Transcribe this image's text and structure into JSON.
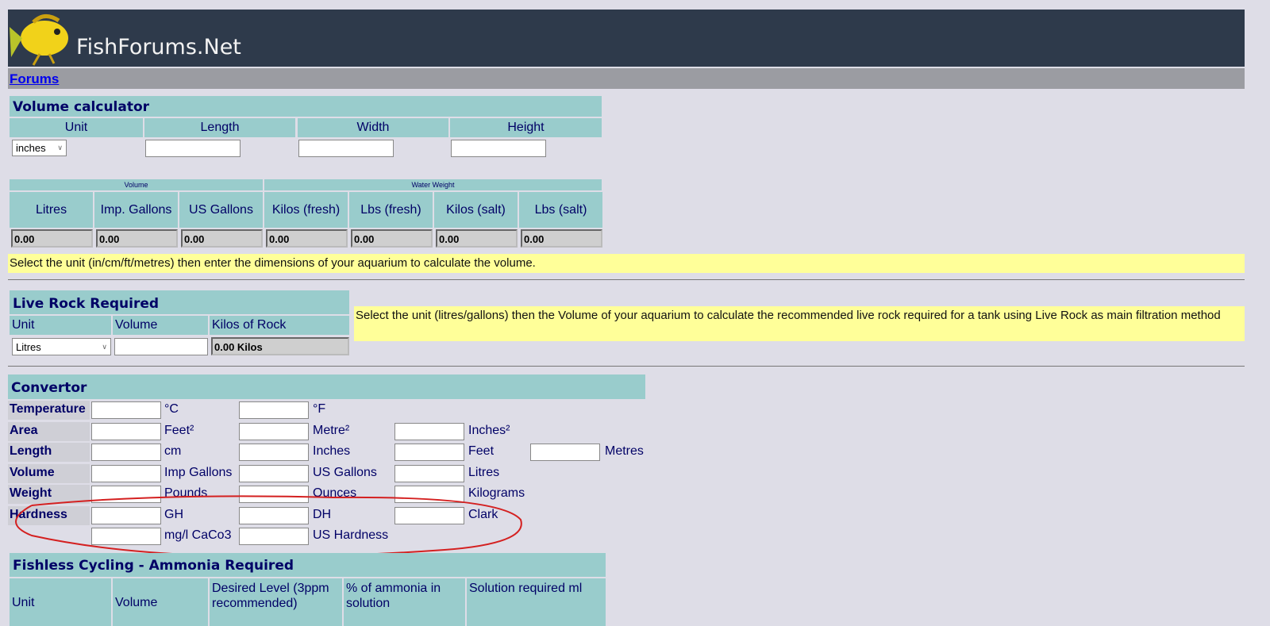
{
  "header": {
    "site_name": "FishForums.Net"
  },
  "nav": {
    "forums_link": "Forums"
  },
  "volume_calculator": {
    "title": "Volume calculator",
    "columns": [
      "Unit",
      "Length",
      "Width",
      "Height"
    ],
    "unit_selected": "inches",
    "group_headers": [
      "Volume",
      "Water Weight"
    ],
    "result_headers": [
      "Litres",
      "Imp. Gallons",
      "US Gallons",
      "Kilos (fresh)",
      "Lbs (fresh)",
      "Kilos (salt)",
      "Lbs (salt)"
    ],
    "result_values": [
      "0.00",
      "0.00",
      "0.00",
      "0.00",
      "0.00",
      "0.00",
      "0.00"
    ],
    "note": "Select the unit (in/cm/ft/metres) then enter the dimensions of your aquarium to calculate the volume."
  },
  "live_rock": {
    "title": "Live Rock Required",
    "columns": [
      "Unit",
      "Volume",
      "Kilos of Rock"
    ],
    "unit_selected": "Litres",
    "result": "0.00 Kilos",
    "note": "Select the unit (litres/gallons) then the Volume of your aquarium to calculate the recommended live rock required for a tank using Live Rock as main filtration method"
  },
  "convertor": {
    "title": "Convertor",
    "rows": [
      {
        "label": "Temperature",
        "units": [
          "°C",
          "°F"
        ]
      },
      {
        "label": "Area",
        "units": [
          "Feet²",
          "Metre²",
          "Inches²"
        ]
      },
      {
        "label": "Length",
        "units": [
          "cm",
          "Inches",
          "Feet",
          "Metres"
        ]
      },
      {
        "label": "Volume",
        "units": [
          "Imp Gallons",
          "US Gallons",
          "Litres"
        ]
      },
      {
        "label": "Weight",
        "units": [
          "Pounds",
          "Ounces",
          "Kilograms"
        ]
      },
      {
        "label": "Hardness",
        "units": [
          "GH",
          "DH",
          "Clark"
        ]
      },
      {
        "label": "",
        "units": [
          "mg/l CaCo3",
          "US Hardness"
        ]
      }
    ],
    "annotation_color": "#d42020"
  },
  "fishless_cycling": {
    "title": "Fishless Cycling - Ammonia Required",
    "columns": [
      "Unit",
      "Volume",
      "Desired Level (3ppm recommended)",
      "% of ammonia in solution",
      "Solution required ml"
    ]
  }
}
